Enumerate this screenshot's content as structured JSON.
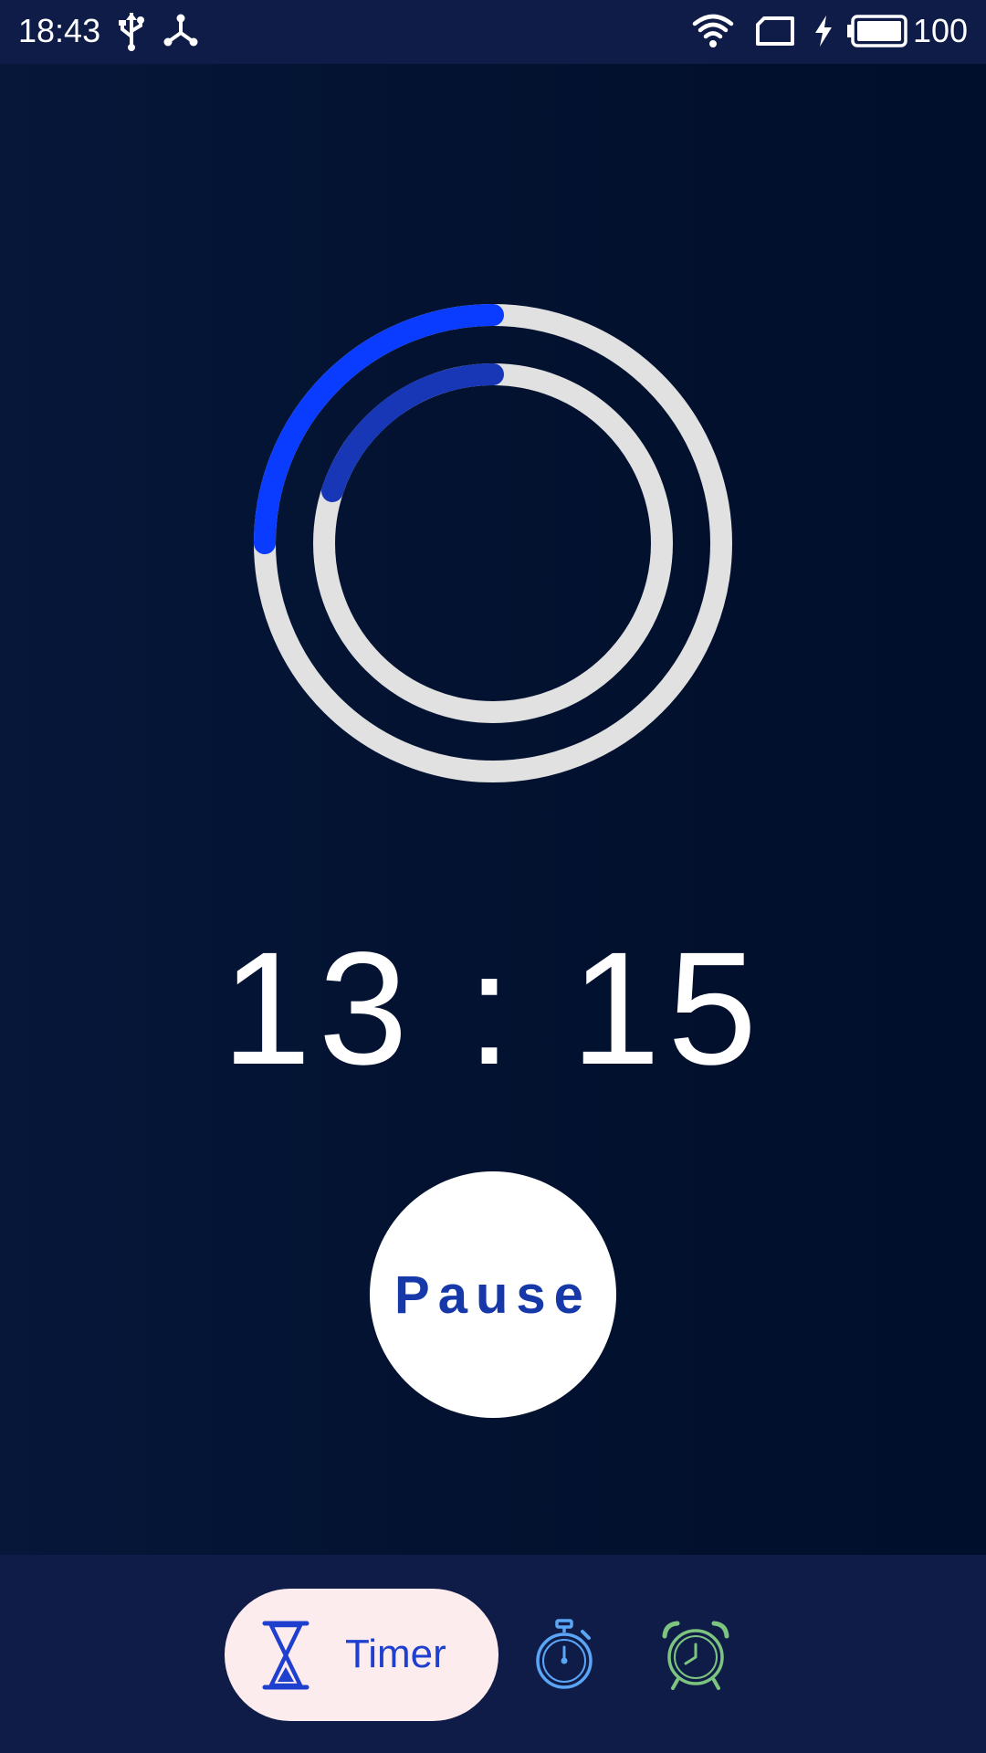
{
  "status_bar": {
    "time": "18:43",
    "battery": "100",
    "icons": [
      "usb-icon",
      "share-network-icon",
      "wifi-icon",
      "sim-card-icon",
      "charging-bolt-icon",
      "battery-icon"
    ]
  },
  "timer": {
    "display": "13 : 15",
    "outer_ring_progress": 0.25,
    "inner_ring_progress": 0.2,
    "colors": {
      "outer_progress": "#0a3cff",
      "inner_progress": "#1737b7",
      "track": "#e1e1e1"
    }
  },
  "controls": {
    "pause_label": "Pause"
  },
  "bottom_nav": {
    "tabs": [
      {
        "label": "Timer",
        "icon": "hourglass-icon",
        "active": true,
        "color": "#1f3fcf",
        "background": "#fdeced"
      },
      {
        "label": "",
        "icon": "stopwatch-icon",
        "active": false,
        "color": "#5aa5f5"
      },
      {
        "label": "",
        "icon": "alarm-clock-icon",
        "active": false,
        "color": "#7cc47f"
      }
    ]
  }
}
